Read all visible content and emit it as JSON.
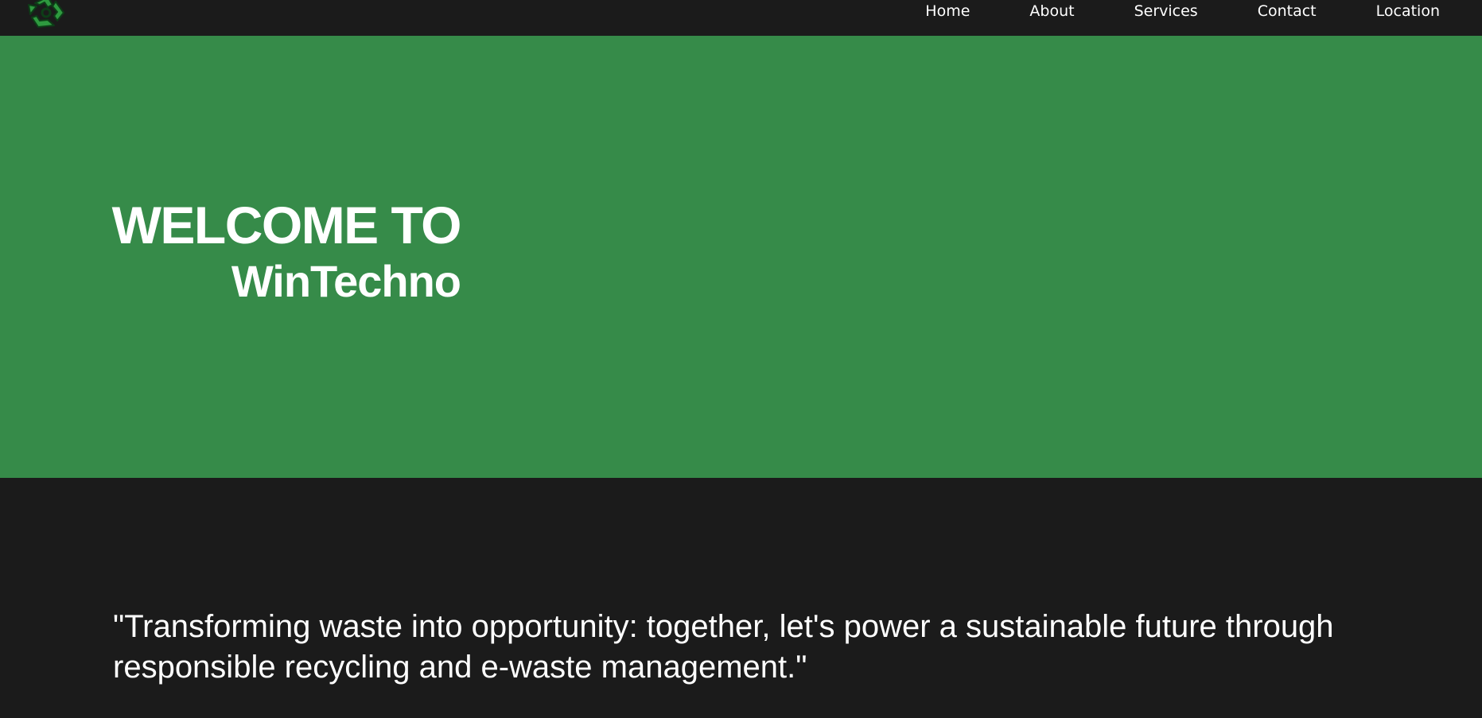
{
  "header": {
    "logo_icon": "recycle-icon",
    "nav": [
      {
        "label": "Home"
      },
      {
        "label": "About"
      },
      {
        "label": "Services"
      },
      {
        "label": "Contact"
      },
      {
        "label": "Location"
      }
    ]
  },
  "hero": {
    "title_line1": "WELCOME TO",
    "title_line2": "WinTechno",
    "background_color": "#368b49"
  },
  "quote": {
    "text": "\"Transforming waste into opportunity: together, let's power a sustainable future through responsible recycling and e-waste management.\""
  },
  "colors": {
    "page_background": "#1b1b1b",
    "text": "#ffffff",
    "accent_green": "#368b49"
  }
}
